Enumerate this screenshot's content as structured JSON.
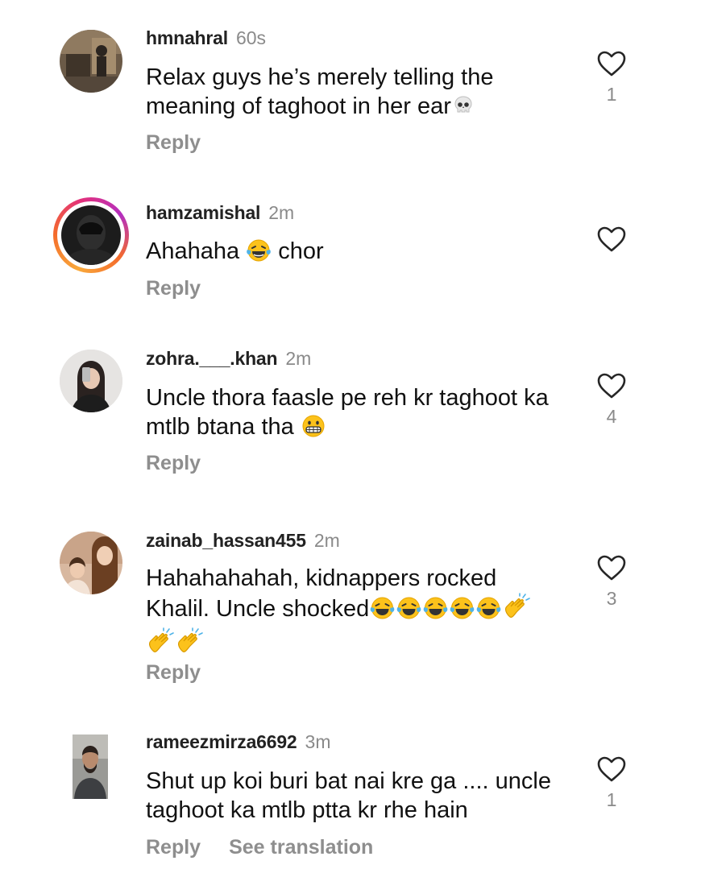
{
  "comments": [
    {
      "username": "hmnahral",
      "time": "60s",
      "text": "Relax guys he’s merely telling the meaning of taghoot in her ear",
      "emoji": "skull-emoji",
      "likes": "1",
      "reply_label": "Reply"
    },
    {
      "username": "hamzamishal",
      "time": "2m",
      "text_before": "Ahahaha",
      "text_after": "chor",
      "emoji": "laughing-emoji",
      "likes": "",
      "reply_label": "Reply",
      "has_story_ring": true
    },
    {
      "username": "zohra.___.khan",
      "time": "2m",
      "text": "Uncle thora faasle pe reh kr taghoot ka mtlb btana tha",
      "emoji": "grimace-emoji",
      "likes": "4",
      "reply_label": "Reply"
    },
    {
      "username": "zainab_hassan455",
      "time": "2m",
      "text": "Hahahahahah, kidnappers rocked Khalil. Uncle shocked",
      "emoji": "laughing-emoji x5, clapping-hands-emoji x3",
      "likes": "3",
      "reply_label": "Reply"
    },
    {
      "username": "rameezmirza6692",
      "time": "3m",
      "text": "Shut up koi buri bat nai kre ga .... uncle taghoot ka mtlb ptta kr rhe hain",
      "likes": "1",
      "reply_label": "Reply",
      "translate_label": "See translation"
    }
  ],
  "colors": {
    "text": "#111111",
    "secondary": "#8e8e8e",
    "story_ring_start": "#f9a93b",
    "story_ring_end": "#b42fbf"
  },
  "icons": {
    "like": "heart-outline-icon"
  }
}
